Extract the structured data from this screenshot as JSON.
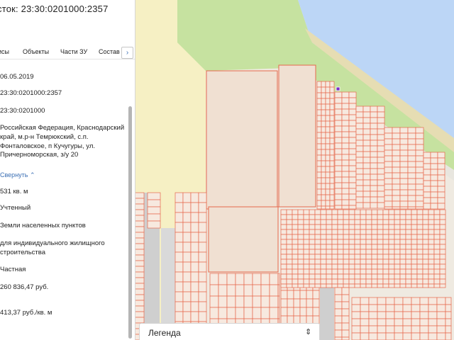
{
  "panel": {
    "title": "сток: 23:30:0201000:2357",
    "tabs": [
      "исы",
      "Объекты",
      "Части ЗУ",
      "Состав"
    ],
    "tab_next_icon": "chevron-right-icon",
    "fields": [
      "06.05.2019",
      "23:30:0201000:2357",
      "23:30:0201000",
      "Российская Федерация, Краснодарский край, м.р-н Темрюкский, с.п. Фонталовское, п Кучугуры, ул. Причерноморская, з/у 20",
      "531 кв. м",
      "Учтенный",
      "Земли населенных пунктов",
      "для индивидуального жилищного строительства",
      "Частная",
      "260 836,47 руб.",
      "413,37 руб./кв. м"
    ],
    "collapse_label": "Свернуть"
  },
  "legend": {
    "label": "Легенда",
    "icon": "chevron-updown-icon"
  },
  "colors": {
    "sea": "#bcd6f6",
    "forest": "#c6e2a0",
    "field": "#f6f0c4",
    "parcel_fill": "#f0e0d2",
    "parcel_stroke": "#e6684c",
    "road": "#ece9e0",
    "block_gray": "#cfcfcf",
    "accent": "#3b6fb4"
  }
}
